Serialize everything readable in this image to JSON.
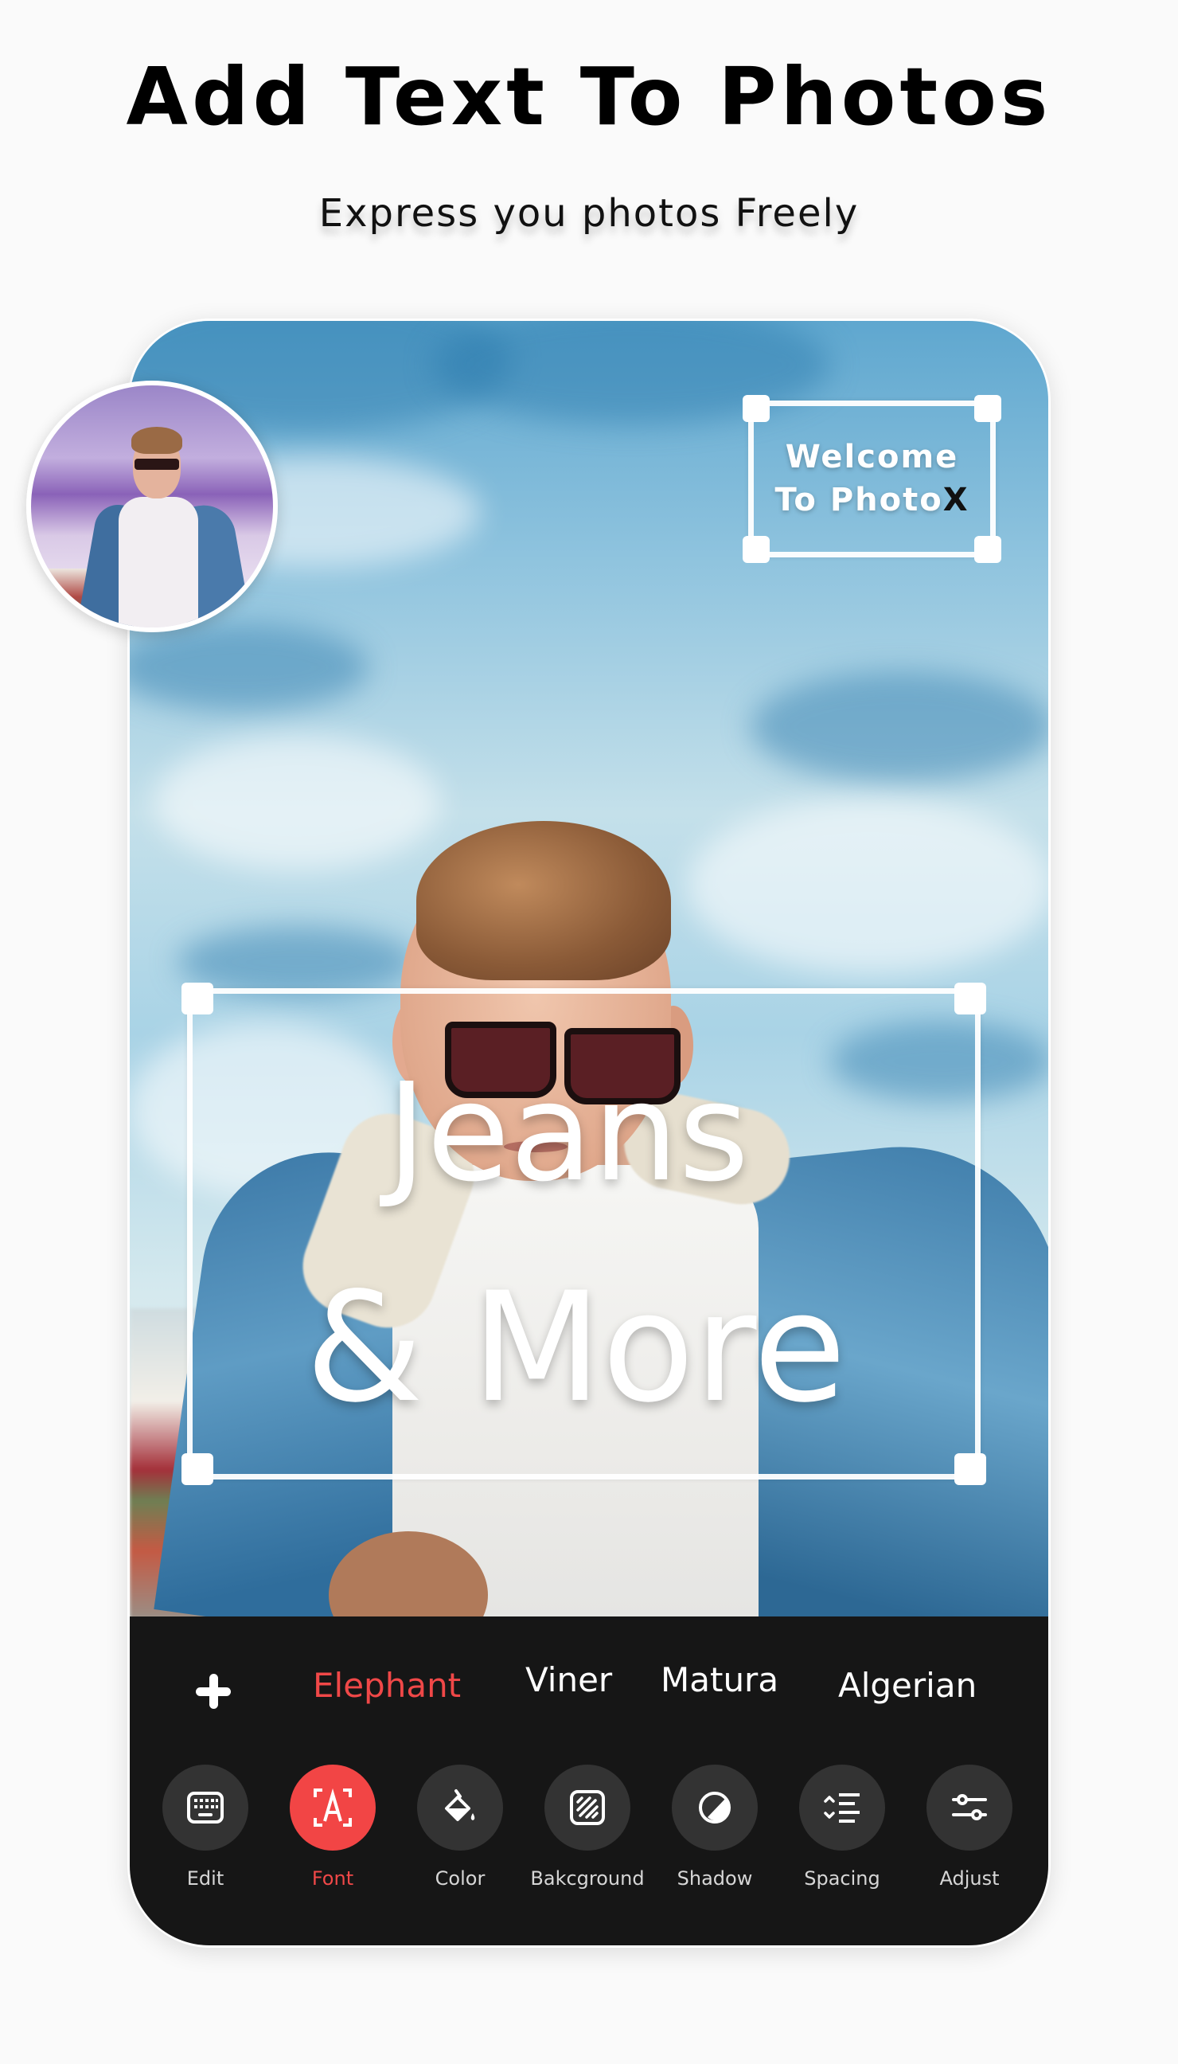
{
  "header": {
    "title": "Add Text To Photos",
    "subtitle": "Express you photos Freely"
  },
  "canvas": {
    "welcome_box": {
      "line1": "Welcome",
      "line2_prefix": "To Photo",
      "line2_accent": "X"
    },
    "main_text": {
      "line1": "Jeans",
      "line2": "& More"
    },
    "thumbnail_alt": "original photo preview"
  },
  "font_bar": {
    "add_icon": "plus-icon",
    "fonts": [
      {
        "label": "Elephant",
        "active": true
      },
      {
        "label": "Viner",
        "active": false
      },
      {
        "label": "Matura",
        "active": false
      },
      {
        "label": "Algerian",
        "active": false
      }
    ]
  },
  "toolbar": {
    "items": [
      {
        "label": "Edit",
        "icon": "keyboard-icon",
        "active": false
      },
      {
        "label": "Font",
        "icon": "font-icon",
        "active": true
      },
      {
        "label": "Color",
        "icon": "paint-bucket-icon",
        "active": false
      },
      {
        "label": "Bakcground",
        "icon": "background-texture-icon",
        "active": false
      },
      {
        "label": "Shadow",
        "icon": "shadow-icon",
        "active": false
      },
      {
        "label": "Spacing",
        "icon": "spacing-icon",
        "active": false
      },
      {
        "label": "Adjust",
        "icon": "sliders-icon",
        "active": false
      }
    ]
  },
  "colors": {
    "accent": "#f04848",
    "panel": "#161616",
    "tool_circle": "#333333",
    "page_background": "#fafafa"
  }
}
